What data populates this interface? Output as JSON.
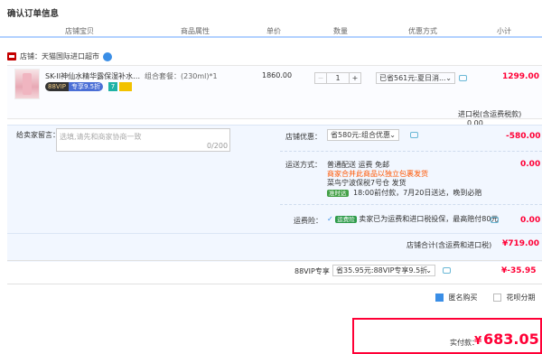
{
  "page_title": "确认订单信息",
  "columns": [
    "店铺宝贝",
    "商品属性",
    "单价",
    "数量",
    "优惠方式",
    "小计"
  ],
  "shop": {
    "label": "店铺：",
    "name": "天猫国际进口超市"
  },
  "item": {
    "name": "SK-II神仙水精华露保湿补水青...",
    "vip_left": "88VIP",
    "vip_right": "专享9.5折",
    "tag7": "7",
    "attr": "组合套餐：(230ml)*1",
    "unit_price": "1860.00",
    "qty": "1",
    "qty_minus": "−",
    "qty_plus": "+",
    "promo": "已省561元:夏日消...",
    "subtotal": "1299.00"
  },
  "tax": {
    "label": "进口税(含运费税款)",
    "value": "0.00"
  },
  "message": {
    "label": "给卖家留言：",
    "placeholder": "选填,请先和商家协商一致",
    "count": "0/200"
  },
  "shop_discount": {
    "label": "店铺优惠：",
    "option": "省580元:组合优惠",
    "value": "-580.00"
  },
  "shipping": {
    "label": "运送方式：",
    "line1": "普通配送 运费 免邮",
    "line2": "商家合并此商品以独立包裹发货",
    "line3": "菜鸟宁波保税7号仓  发货",
    "badge": "准时达",
    "line4": "18:00前付款，7月20日送达，晚到必赔",
    "value": "0.00"
  },
  "insurance": {
    "label": "运费险：",
    "tag": "运费险",
    "text": "卖家已为运费和进口税投保，最高赔付80元",
    "value": "0.00"
  },
  "shop_total": {
    "label": "店铺合计(含运费和进口税)",
    "value": "¥719.00"
  },
  "vip88": {
    "label": "88VIP专享",
    "option": "省35.95元:88VIP专享9.5折",
    "value": "¥-35.95"
  },
  "options": {
    "anonymous": "匿名购买",
    "huabei": "花呗分期"
  },
  "final": {
    "label": "实付款：",
    "currency": "¥",
    "amount": "683.05"
  }
}
